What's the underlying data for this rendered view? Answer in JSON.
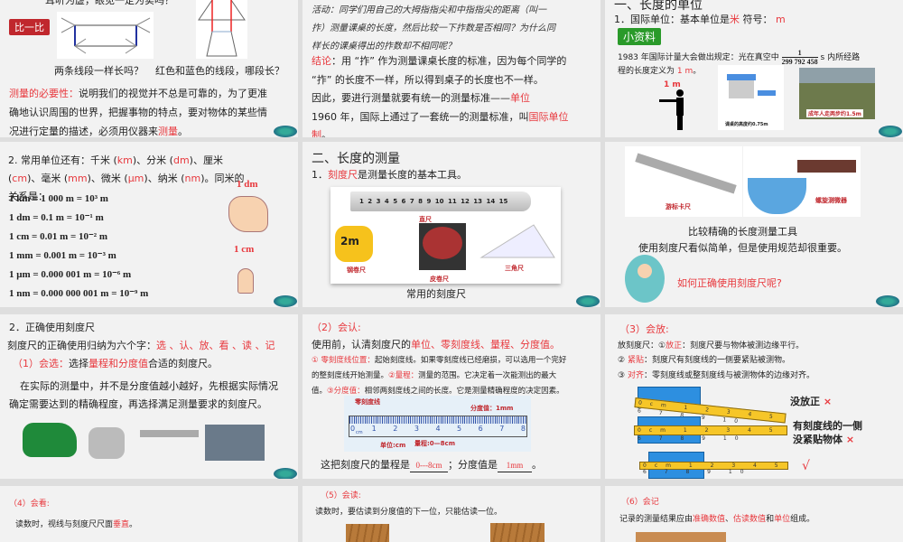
{
  "slides": {
    "s1": {
      "top": "耳听为虚，眼见一定为实吗？",
      "badge": "比一比",
      "cap1": "两条线段一样长吗？",
      "cap2": "红色和蓝色的线段，哪段长？",
      "p": [
        [
          {
            "t": "测量的必要性：",
            "r": 1
          },
          {
            "t": "说明我们的视觉并不总是可靠的，为了更准"
          }
        ],
        [
          {
            "t": "确地认识周围的世界，把握事物的特点，要对物体的某些情"
          }
        ],
        [
          {
            "t": "况进行定量的描述，必须用仪器来"
          },
          {
            "t": "测量",
            "r": 1
          },
          {
            "t": "。"
          }
        ]
      ]
    },
    "s2": {
      "activity": [
        "活动：同学们用自己的大拇指指尖和中指指尖的距离（叫一",
        "拃）测量课桌的长度，然后比较一下拃数是否相同？为什么同",
        "样长的课桌得出的拃数却不相同呢？"
      ],
      "p": [
        [
          {
            "t": "结论",
            "r": 1
          },
          {
            "t": "：用 “拃” 作为测量课桌长度的标准，因为每个同学的"
          }
        ],
        [
          {
            "t": " “拃” 的长度不一样，所以得到桌子的长度也不一样。"
          }
        ],
        [
          {
            "t": "因此，要进行测量就要有统一的测量标准——"
          },
          {
            "t": "单位",
            "r": 1
          }
        ],
        [
          {
            "t": "1960 年，国际上通过了一套统一的测量标准，叫"
          },
          {
            "t": "国际单位",
            "r": 1
          }
        ],
        [
          {
            "t": "制",
            "r": 1
          },
          {
            "t": "。"
          }
        ]
      ]
    },
    "s3": {
      "title": "一、长度的单位",
      "l1": [
        {
          "t": "1．国际单位：基本单位是"
        },
        {
          "t": "米",
          "r": 1
        },
        {
          "t": " 符号： "
        },
        {
          "t": "m",
          "r": 1
        }
      ],
      "badge": "小资料",
      "l2a": "1983 年国际计量大会做出规定：光在真空中",
      "num": "1",
      "den": "299 792 458",
      "l2b": "s 内所经路",
      "l3": [
        {
          "t": "程的长度定义为 "
        },
        {
          "t": "1 m",
          "r": 1
        },
        {
          "t": "。"
        }
      ],
      "mlabel": "1 m",
      "desk_cap": "课桌的高度约0.75m",
      "walk_cap": "成年人走两步约1.5m"
    },
    "s4": {
      "p": [
        [
          {
            "t": "2. 常用单位还有：千米 ("
          },
          {
            "t": "km",
            "r": 1
          },
          {
            "t": ")、分米 ("
          },
          {
            "t": "dm",
            "r": 1
          },
          {
            "t": ")、厘米"
          }
        ],
        [
          {
            "t": "("
          },
          {
            "t": "cm",
            "r": 1
          },
          {
            "t": ")、毫米 ("
          },
          {
            "t": "mm",
            "r": 1
          },
          {
            "t": ")、微米 ("
          },
          {
            "t": "μm",
            "r": 1
          },
          {
            "t": ")、纳米 ("
          },
          {
            "t": "nm",
            "r": 1
          },
          {
            "t": ")。同米的"
          }
        ],
        [
          {
            "t": "关系是："
          }
        ]
      ],
      "formulas": [
        "1 km = 1 000 m = 10³ m",
        "1 dm = 0.1 m = 10⁻¹ m",
        "1 cm = 0.01 m = 10⁻² m",
        "1 mm = 0.001 m = 10⁻³ m",
        "1 μm = 0.000 001 m = 10⁻⁶ m",
        "1 nm = 0.000 000 001 m = 10⁻⁹ m"
      ],
      "dm": "1 dm",
      "cm": "1 cm"
    },
    "s5": {
      "title": "二、长度的测量",
      "l1": [
        {
          "t": "1．"
        },
        {
          "t": "刻度尺",
          "r": 1
        },
        {
          "t": "是测量长度的基本工具。"
        }
      ],
      "ruler_nums": "1 2 3 4 5 6 7 8 9 10 11 12 13 14 15",
      "straight": "直尺",
      "tape": "钢卷尺",
      "leather": "皮卷尺",
      "triangle": "三角尺",
      "tape_label": "2m",
      "caption": "常用的刻度尺"
    },
    "s6": {
      "caliper": "游标卡尺",
      "micrometer": "螺旋测微器",
      "l1": "比较精确的长度测量工具",
      "l2": "使用刻度尺看似简单，但是使用规范却很重要。",
      "q": "如何正确使用刻度尺呢?"
    },
    "s7": {
      "l1": "2．正确使用刻度尺",
      "l2": [
        {
          "t": "刻度尺的正确使用归纳为六个字："
        },
        {
          "t": "选 、认、放、看 、读 、记",
          "r": 1
        }
      ],
      "l3": [
        {
          "t": "（1）会选：",
          "r": 1
        },
        {
          "t": "选择"
        },
        {
          "t": "量程和分度值",
          "r": 1
        },
        {
          "t": "合适的刻度尺。"
        }
      ],
      "l4": "在实际的测量中，并不是分度值越小越好，先根据实际情况",
      "l5": "确定需要达到的精确程度，再选择满足测量要求的刻度尺。"
    },
    "s8": {
      "title": "（2）会认:",
      "l1": [
        {
          "t": "使用前，认清刻度尺的"
        },
        {
          "t": "单位、零刻度线、量程、分度值。",
          "r": 1
        }
      ],
      "p": [
        [
          {
            "t": "① 零刻度线位置：",
            "r": 1
          },
          {
            "t": "起始刻度线。如果零刻度线已经磨损，可以选用一个完好"
          }
        ],
        [
          {
            "t": "的整刻度线开始测量。"
          },
          {
            "t": "②量程：",
            "r": 1
          },
          {
            "t": "测量的范围。它决定着一次能测出的最大"
          }
        ],
        [
          {
            "t": "值。"
          },
          {
            "t": "③分度值：",
            "r": 1
          },
          {
            "t": "相邻两刻度线之间的长度。它是测量精确程度的决定因素。"
          }
        ]
      ],
      "zero": "零刻度线",
      "div": "分度值：1mm",
      "unit": "单位:cm",
      "range": "量程:0—8cm",
      "unit_small": "cm",
      "nums": [
        "0",
        "1",
        "2",
        "3",
        "4",
        "5",
        "6",
        "7",
        "8"
      ],
      "ans_a": "这把刻度尺的量程是",
      "ans1": "0---8cm",
      "ans_b": "；分度值是",
      "ans2": "1mm",
      "ans_c": "。"
    },
    "s9": {
      "title": "（3）会放:",
      "l1": [
        {
          "t": "放刻度尺：①"
        },
        {
          "t": "放正",
          "r": 1
        },
        {
          "t": "：刻度尺要与物体被测边缘平行。"
        }
      ],
      "l2": [
        {
          "t": "② "
        },
        {
          "t": "紧贴",
          "r": 1
        },
        {
          "t": "：刻度尺有刻度线的一侧要紧贴被测物。"
        }
      ],
      "l3": [
        {
          "t": "③ "
        },
        {
          "t": "对齐",
          "r": 1
        },
        {
          "t": "：零刻度线或整刻度线与被测物体的边缘对齐。"
        }
      ],
      "wrong1": "没放正",
      "wrong2a": "有刻度线的一侧",
      "wrong2b": "没紧贴物体",
      "x": "×",
      "check": "√",
      "ruler_text": "0cm 1 2 3 4 5 6 7 8 9 10"
    },
    "s10": {
      "title": "（4）会看:",
      "l1": [
        {
          "t": "读数时，视线与刻度尺尺面"
        },
        {
          "t": "垂直",
          "r": 1
        },
        {
          "t": "。"
        }
      ]
    },
    "s11": {
      "title": "（5）会读:",
      "l1": "读数时，要估读到分度值的下一位，只能估读一位。"
    },
    "s12": {
      "title": "（6）会记",
      "l1": [
        {
          "t": "记录的测量结果应由"
        },
        {
          "t": "准确数值",
          "r": 1
        },
        {
          "t": "、"
        },
        {
          "t": "估读数值",
          "r": 1
        },
        {
          "t": "和"
        },
        {
          "t": "单位",
          "r": 1
        },
        {
          "t": "组成。"
        }
      ]
    }
  },
  "colors": {
    "red": "#e8383d",
    "badge_red": "#c0272d",
    "badge_green": "#2a9a2a",
    "slide_bg": "#f2f2f2"
  }
}
